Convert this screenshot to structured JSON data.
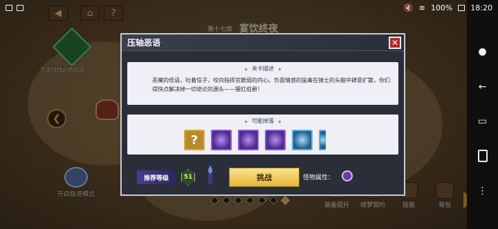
{
  "status_bar": {
    "battery": "100%",
    "time": "18:20"
  },
  "top_buttons": [
    {
      "name": "back-button",
      "icon": "arrow-left-icon"
    },
    {
      "name": "home-button",
      "icon": "home-icon"
    },
    {
      "name": "help-button",
      "label": "?"
    }
  ],
  "map": {
    "chapter_num": "第十七章",
    "chapter_title": "宴饮终夜",
    "node_label": "下次讨伐必然出现",
    "fast_mode_label": "开启极速模式"
  },
  "bottom_bar": {
    "items": [
      {
        "label": "装备提升"
      },
      {
        "label": "绯梦契约"
      },
      {
        "label": "技能"
      },
      {
        "label": "背包"
      }
    ]
  },
  "dialog": {
    "title": "压轴恶语",
    "close_label": "✕",
    "desc_caption": "关卡描述",
    "description": "恶魔的低语，吐着信子，咬向指挥官脆弱的内心。负面情感的猛毒在骑士的头脑中肆意扩散，你们得快点解决掉一切诡论的源头——猩红伯爵！",
    "drops_caption": "可能掉落",
    "unknown_drop_label": "?",
    "recommended_level_label": "推荐等级",
    "recommended_level": "51",
    "challenge_label": "挑战",
    "monster_attr_label": "怪物属性："
  },
  "colors": {
    "accent": "#f5c04f",
    "dialog_bg": "#2a2e38",
    "panel_bg": "#eef0f5",
    "challenge": "#f3c94d"
  }
}
